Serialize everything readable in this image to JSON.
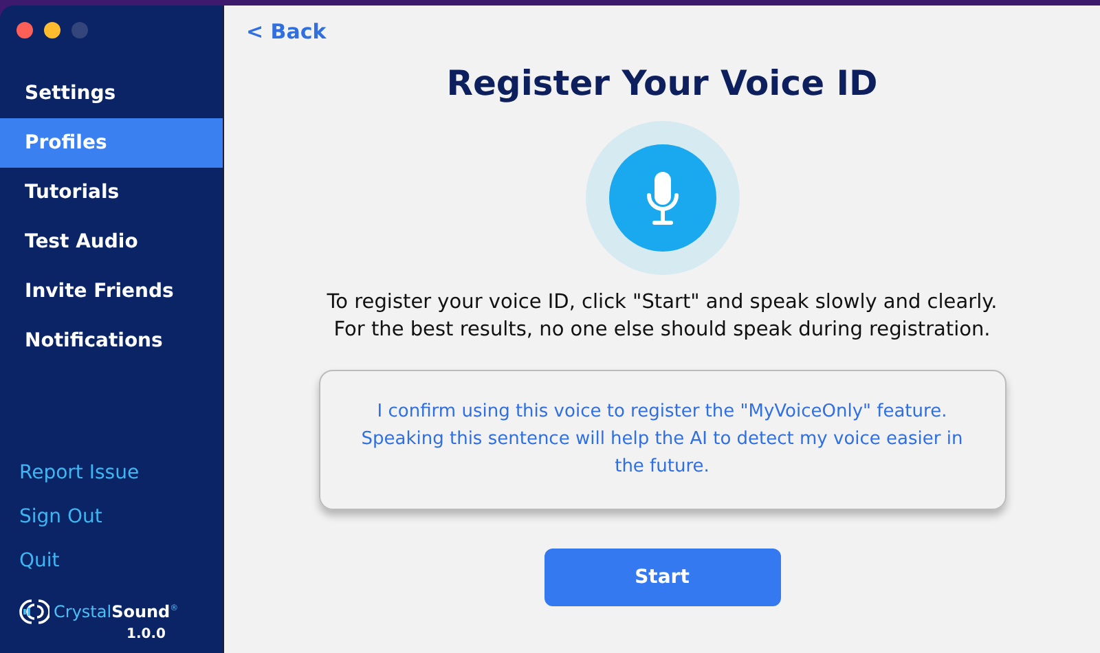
{
  "window": {
    "controls": [
      {
        "kind": "close",
        "disabled": false
      },
      {
        "kind": "minimize",
        "disabled": false
      },
      {
        "kind": "zoom",
        "disabled": true
      }
    ]
  },
  "sidebar": {
    "items": [
      {
        "label": "Settings",
        "selected": false
      },
      {
        "label": "Profiles",
        "selected": true
      },
      {
        "label": "Tutorials",
        "selected": false
      },
      {
        "label": "Test Audio",
        "selected": false
      },
      {
        "label": "Invite Friends",
        "selected": false
      },
      {
        "label": "Notifications",
        "selected": false
      }
    ],
    "links": [
      "Report Issue",
      "Sign Out",
      "Quit"
    ],
    "logo": {
      "name": "Crystal**Sound**$^{®}$",
      "version": "1.0.0"
    }
  },
  "main": {
    "back": "< Back",
    "title": "Register Your Voice ID",
    "instructions": [
      "To register your voice ID, click \"Start\" and speak slowly and clearly.",
      "For the best results, no one else should speak during registration."
    ],
    "sentence": "I confirm using this voice to register the \"MyVoiceOnly\" feature. Speaking this sentence will help the AI to detect my voice easier in the future.",
    "start_button": "Start"
  }
}
